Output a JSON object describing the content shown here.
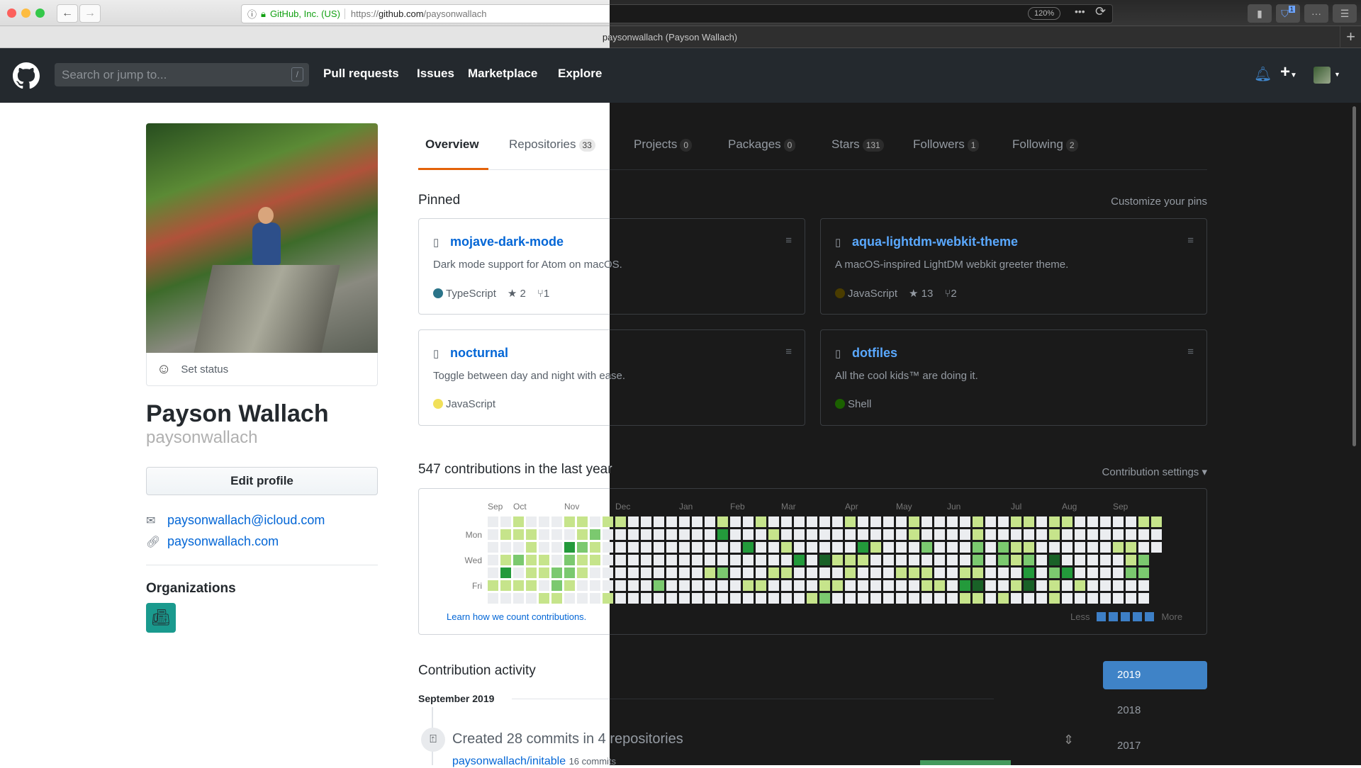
{
  "browser": {
    "security_label": "GitHub, Inc. (US)",
    "url_prefix": "https://",
    "url_domain": "github.com",
    "url_path": "/paysonwallach",
    "zoom": "120%",
    "tab_title": "paysonwallach (Payson Wallach)",
    "extension_badge": "1"
  },
  "nav": {
    "search_placeholder": "Search or jump to...",
    "search_shortcut": "/",
    "links": [
      "Pull requests",
      "Issues",
      "Marketplace",
      "Explore"
    ]
  },
  "profile": {
    "set_status": "Set status",
    "name": "Payson Wallach",
    "login": "paysonwallach",
    "edit_profile": "Edit profile",
    "email": "paysonwallach@icloud.com",
    "website": "paysonwallach.com",
    "organizations_heading": "Organizations"
  },
  "tabs": [
    {
      "label": "Overview",
      "count": ""
    },
    {
      "label": "Repositories",
      "count": "33"
    },
    {
      "label": "Projects",
      "count": "0"
    },
    {
      "label": "Packages",
      "count": "0"
    },
    {
      "label": "Stars",
      "count": "131"
    },
    {
      "label": "Followers",
      "count": "1"
    },
    {
      "label": "Following",
      "count": "2"
    }
  ],
  "pinned": {
    "heading": "Pinned",
    "customize": "Customize your pins",
    "repos": [
      {
        "name": "mojave-dark-mode",
        "description": "Dark mode support for Atom on macOS.",
        "language": "TypeScript",
        "lang_color": "#2b7489",
        "stars": "2",
        "forks": "1"
      },
      {
        "name": "aqua-lightdm-webkit-theme",
        "description": "A macOS-inspired LightDM webkit greeter theme.",
        "language": "JavaScript",
        "lang_color": "#f1e05a",
        "stars": "13",
        "forks": "2"
      },
      {
        "name": "nocturnal",
        "description": "Toggle between day and night with ease.",
        "language": "JavaScript",
        "lang_color": "#f1e05a",
        "stars": "",
        "forks": ""
      },
      {
        "name": "dotfiles",
        "description": "All the cool kids™ are doing it.",
        "language": "Shell",
        "lang_color": "#89e051",
        "stars": "",
        "forks": ""
      }
    ]
  },
  "contributions": {
    "heading": "547 contributions in the last year",
    "settings": "Contribution settings ▾",
    "learn": "Learn how we count contributions.",
    "less": "Less",
    "more": "More",
    "legend_colors": [
      "#3d7fc6",
      "#3d7fc6",
      "#3d7fc6",
      "#3d7fc6",
      "#3d7fc6"
    ],
    "level_colors": [
      "#ebedf0",
      "#c6e48b",
      "#7bc96f",
      "#239a3b",
      "#196127"
    ],
    "day_labels": [
      {
        "row": 1,
        "label": "Mon"
      },
      {
        "row": 3,
        "label": "Wed"
      },
      {
        "row": 5,
        "label": "Fri"
      }
    ],
    "months": [
      {
        "week": 0,
        "label": "Sep"
      },
      {
        "week": 2,
        "label": "Oct"
      },
      {
        "week": 6,
        "label": "Nov"
      },
      {
        "week": 10,
        "label": "Dec"
      },
      {
        "week": 15,
        "label": "Jan"
      },
      {
        "week": 19,
        "label": "Feb"
      },
      {
        "week": 23,
        "label": "Mar"
      },
      {
        "week": 28,
        "label": "Apr"
      },
      {
        "week": 32,
        "label": "May"
      },
      {
        "week": 36,
        "label": "Jun"
      },
      {
        "week": 41,
        "label": "Jul"
      },
      {
        "week": 45,
        "label": "Aug"
      },
      {
        "week": 49,
        "label": "Sep"
      }
    ],
    "weeks": [
      [
        0,
        0,
        0,
        0,
        0,
        1,
        0
      ],
      [
        0,
        1,
        0,
        1,
        3,
        1,
        0
      ],
      [
        1,
        1,
        0,
        2,
        0,
        1,
        0
      ],
      [
        0,
        1,
        1,
        1,
        1,
        1,
        0
      ],
      [
        0,
        0,
        0,
        1,
        1,
        0,
        1
      ],
      [
        0,
        0,
        0,
        0,
        2,
        2,
        1
      ],
      [
        1,
        0,
        3,
        2,
        2,
        1,
        0
      ],
      [
        1,
        1,
        2,
        1,
        1,
        0,
        0
      ],
      [
        0,
        2,
        1,
        1,
        0,
        0,
        0
      ],
      [
        1,
        0,
        0,
        0,
        0,
        0,
        1
      ],
      [
        1,
        0,
        0,
        0,
        0,
        0,
        0
      ],
      [
        0,
        0,
        0,
        0,
        0,
        0,
        0
      ],
      [
        0,
        0,
        0,
        0,
        0,
        0,
        0
      ],
      [
        0,
        0,
        0,
        0,
        0,
        2,
        0
      ],
      [
        0,
        0,
        0,
        0,
        0,
        0,
        0
      ],
      [
        0,
        0,
        0,
        0,
        0,
        0,
        0
      ],
      [
        0,
        0,
        0,
        0,
        0,
        0,
        0
      ],
      [
        0,
        0,
        0,
        0,
        1,
        0,
        0
      ],
      [
        1,
        3,
        0,
        0,
        2,
        0,
        0
      ],
      [
        0,
        0,
        0,
        0,
        0,
        0,
        0
      ],
      [
        0,
        0,
        3,
        0,
        0,
        1,
        0
      ],
      [
        1,
        0,
        0,
        0,
        0,
        1,
        0
      ],
      [
        0,
        1,
        0,
        0,
        1,
        0,
        0
      ],
      [
        0,
        0,
        1,
        0,
        1,
        0,
        0
      ],
      [
        0,
        0,
        0,
        3,
        0,
        0,
        0
      ],
      [
        0,
        0,
        0,
        0,
        0,
        0,
        1
      ],
      [
        0,
        0,
        0,
        4,
        0,
        1,
        2
      ],
      [
        0,
        0,
        0,
        1,
        0,
        1,
        0
      ],
      [
        1,
        0,
        0,
        1,
        1,
        0,
        0
      ],
      [
        0,
        0,
        3,
        1,
        0,
        0,
        0
      ],
      [
        0,
        0,
        1,
        0,
        0,
        0,
        0
      ],
      [
        0,
        0,
        0,
        0,
        0,
        0,
        0
      ],
      [
        0,
        0,
        0,
        0,
        1,
        0,
        0
      ],
      [
        1,
        1,
        0,
        0,
        1,
        0,
        0
      ],
      [
        0,
        0,
        2,
        0,
        1,
        1,
        0
      ],
      [
        0,
        0,
        0,
        0,
        0,
        1,
        0
      ],
      [
        0,
        0,
        0,
        0,
        0,
        0,
        0
      ],
      [
        0,
        0,
        0,
        0,
        1,
        3,
        1
      ],
      [
        1,
        1,
        2,
        2,
        1,
        4,
        1
      ],
      [
        0,
        0,
        0,
        0,
        0,
        0,
        0
      ],
      [
        0,
        0,
        2,
        2,
        0,
        0,
        1
      ],
      [
        1,
        0,
        1,
        1,
        0,
        1,
        0
      ],
      [
        1,
        0,
        1,
        2,
        3,
        4,
        0
      ],
      [
        0,
        0,
        0,
        0,
        0,
        0,
        0
      ],
      [
        1,
        1,
        0,
        4,
        2,
        1,
        1
      ],
      [
        1,
        0,
        0,
        0,
        3,
        0,
        0
      ],
      [
        0,
        0,
        0,
        0,
        0,
        1,
        0
      ],
      [
        0,
        0,
        0,
        0,
        0,
        0,
        0
      ],
      [
        0,
        0,
        0,
        0,
        0,
        0,
        0
      ],
      [
        0,
        0,
        1,
        0,
        0,
        0,
        0
      ],
      [
        0,
        0,
        1,
        1,
        2,
        0,
        0
      ],
      [
        1,
        0,
        0,
        2,
        2,
        0,
        0
      ],
      [
        1,
        0,
        0
      ]
    ]
  },
  "activity": {
    "heading": "Contribution activity",
    "month": "September 2019",
    "summary": "Created 28 commits in 4 repositories",
    "repo": "paysonwallach/initable",
    "repo_commits": "16 commits",
    "years": [
      "2019",
      "2018",
      "2017"
    ],
    "selected_year_color": "#3f83c7"
  }
}
